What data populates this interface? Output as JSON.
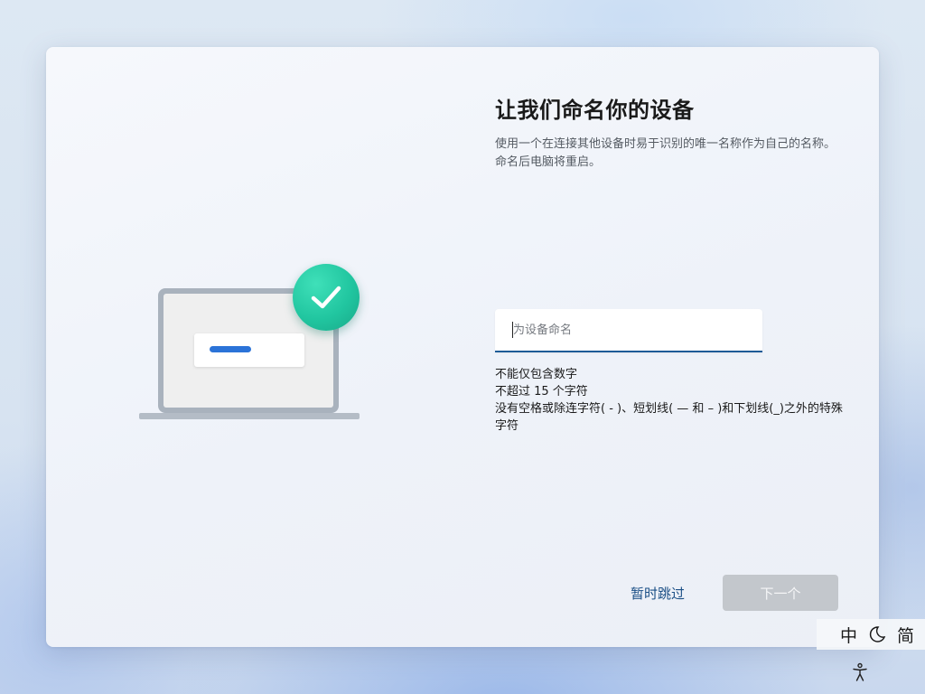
{
  "setup": {
    "title": "让我们命名你的设备",
    "description": "使用一个在连接其他设备时易于识别的唯一名称作为自己的名称。命名后电脑将重启。",
    "name_input": {
      "placeholder": "为设备命名",
      "value": ""
    },
    "rules": [
      "不能仅包含数字",
      "不超过 15 个字符",
      "没有空格或除连字符( - )、短划线( — 和 – )和下划线(_)之外的特殊字符"
    ],
    "skip_label": "暂时跳过",
    "next_label": "下一个"
  },
  "ime": {
    "mode": "中",
    "script": "简",
    "icon": "moon-icon"
  },
  "icons": {
    "check": "checkmark-icon",
    "accessibility": "accessibility-icon"
  },
  "colors": {
    "accent": "#1d5b97",
    "check_green": "#21c6a0",
    "laptop_bar": "#2b73d8",
    "disabled_button": "#c3c7cc"
  }
}
